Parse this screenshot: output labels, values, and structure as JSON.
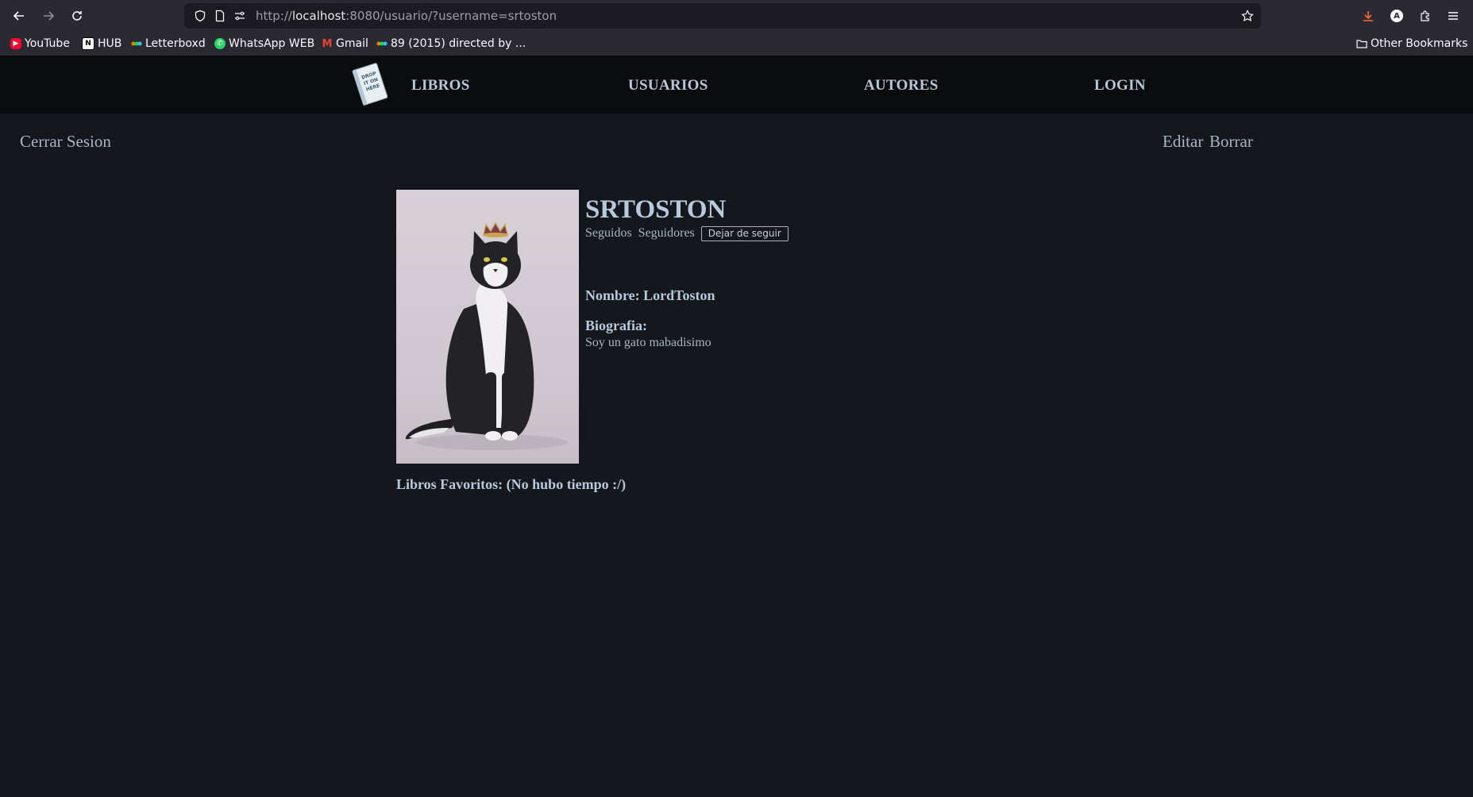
{
  "browser": {
    "url_scheme": "http://",
    "url_host": "localhost",
    "url_rest": ":8080/usuario/?username=srtoston",
    "bookmarks": [
      {
        "label": "YouTube",
        "icon": "youtube-icon",
        "color": "#ff0033"
      },
      {
        "label": "HUB",
        "icon": "notion-icon",
        "color": "#ffffff"
      },
      {
        "label": "Letterboxd",
        "icon": "letterboxd-icon",
        "color": "#40bcf4"
      },
      {
        "label": "WhatsApp WEB",
        "icon": "whatsapp-icon",
        "color": "#25d366"
      },
      {
        "label": "Gmail",
        "icon": "gmail-icon",
        "color": "#ea4335"
      },
      {
        "label": "89 (2015) directed by ...",
        "icon": "letterboxd-icon",
        "color": "#40bcf4"
      }
    ],
    "other_bookmarks": "Other Bookmarks",
    "avatar_letter": "A"
  },
  "site": {
    "logo_text": "DROP IT ON HERE",
    "nav": [
      "LIBROS",
      "USUARIOS",
      "AUTORES",
      "LOGIN"
    ]
  },
  "actions": {
    "logout": "Cerrar Sesion",
    "edit": "Editar",
    "delete": "Borrar"
  },
  "profile": {
    "username": "SRTOSTON",
    "following": "Seguidos",
    "followers": "Seguidores",
    "unfollow": "Dejar de seguir",
    "name_line": "Nombre: LordToston",
    "bio_label": "Biografia:",
    "bio": "Soy un gato mabadisimo",
    "favorites": "Libros Favoritos: (No hubo tiempo :/)"
  },
  "colors": {
    "page_bg": "#14171c",
    "header_bg": "#0a0c0e",
    "nav_text": "#b8c7d9",
    "accent_text": "#b9c9dc"
  }
}
